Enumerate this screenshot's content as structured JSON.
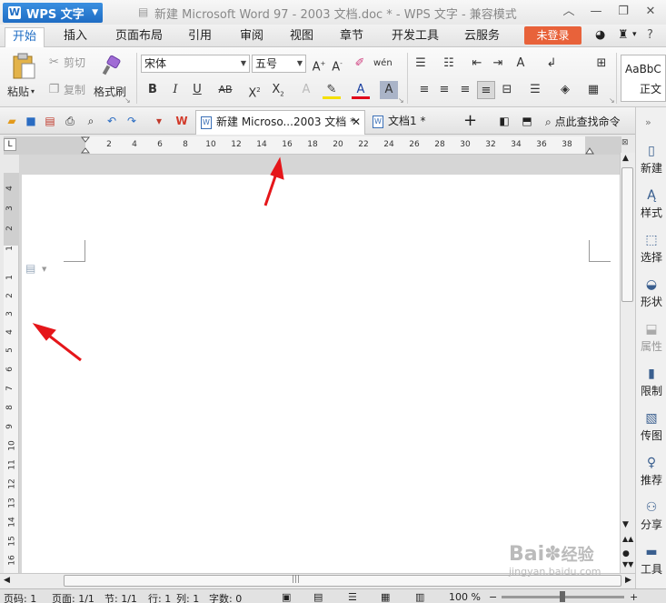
{
  "app": {
    "name": "WPS 文字",
    "title": "新建 Microsoft Word 97 - 2003 文档.doc * - WPS 文字 - 兼容模式"
  },
  "tabs": [
    {
      "label": "开始",
      "active": true
    },
    {
      "label": "插入"
    },
    {
      "label": "页面布局"
    },
    {
      "label": "引用"
    },
    {
      "label": "审阅"
    },
    {
      "label": "视图"
    },
    {
      "label": "章节"
    },
    {
      "label": "开发工具"
    },
    {
      "label": "云服务"
    }
  ],
  "login_label": "未登录",
  "ribbon": {
    "paste": "粘贴",
    "cut": "剪切",
    "copy": "复制",
    "format_painter": "格式刷",
    "font_name": "宋体",
    "font_size": "五号",
    "style_preview": "AaBbC",
    "style_name": "正文"
  },
  "doc_tabs": [
    {
      "label": "新建 Microso...2003 文档 *",
      "active": true
    },
    {
      "label": "文档1 *"
    }
  ],
  "search_label": "点此查找命令",
  "ruler": {
    "h_ticks": [
      "4",
      "2",
      "2",
      "4",
      "6",
      "8",
      "10",
      "12",
      "14",
      "16",
      "18",
      "20",
      "22",
      "24",
      "26",
      "28",
      "30",
      "32",
      "34",
      "36",
      "38",
      "40"
    ],
    "v_ticks": [
      "4",
      "3",
      "2",
      "1",
      "1",
      "2",
      "3",
      "4",
      "5",
      "6",
      "7",
      "8",
      "9",
      "10",
      "11",
      "12",
      "13",
      "14",
      "15",
      "16"
    ]
  },
  "task_pane": [
    {
      "label": "新建",
      "icon": "new-doc-icon"
    },
    {
      "label": "样式",
      "icon": "style-icon"
    },
    {
      "label": "选择",
      "icon": "select-icon"
    },
    {
      "label": "形状",
      "icon": "shape-icon"
    },
    {
      "label": "属性",
      "icon": "property-icon",
      "disabled": true
    },
    {
      "label": "限制",
      "icon": "restrict-icon"
    },
    {
      "label": "传图",
      "icon": "send-picture-icon"
    },
    {
      "label": "推荐",
      "icon": "recommend-icon"
    },
    {
      "label": "分享",
      "icon": "share-icon"
    },
    {
      "label": "工具",
      "icon": "tools-icon"
    }
  ],
  "status": {
    "page_no": "页码: 1",
    "pages": "页面: 1/1",
    "section": "节: 1/1",
    "row": "行: 1",
    "col": "列: 1",
    "words": "字数: 0",
    "zoom": "100 %"
  },
  "watermark": {
    "line1": "Bai",
    "line2": "经验",
    "url": "jingyan.baidu.com"
  },
  "colors": {
    "accent": "#1f6dc4",
    "login": "#e8623a",
    "arrow": "#e5161a"
  }
}
